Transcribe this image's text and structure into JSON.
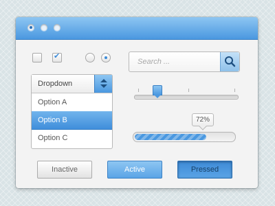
{
  "window": {
    "title_dots": [
      "active",
      "inactive",
      "inactive"
    ]
  },
  "controls": {
    "checkbox_unchecked": false,
    "checkbox_checked": true,
    "radio_unselected": false,
    "radio_selected": true
  },
  "dropdown": {
    "label": "Dropdown",
    "options": [
      "Option A",
      "Option B",
      "Option C"
    ],
    "selected_index": 1
  },
  "search": {
    "placeholder": "Search ...",
    "icon": "search-icon"
  },
  "slider": {
    "value_fraction": 0.22
  },
  "progress": {
    "value_label": "72%",
    "value_percent": 72
  },
  "buttons": {
    "inactive_label": "Inactive",
    "active_label": "Active",
    "pressed_label": "Pressed"
  },
  "colors": {
    "accent": "#4a98e0",
    "accent_light": "#8ec6f2",
    "background": "#d9e3e6",
    "panel": "#f3f3f3"
  }
}
